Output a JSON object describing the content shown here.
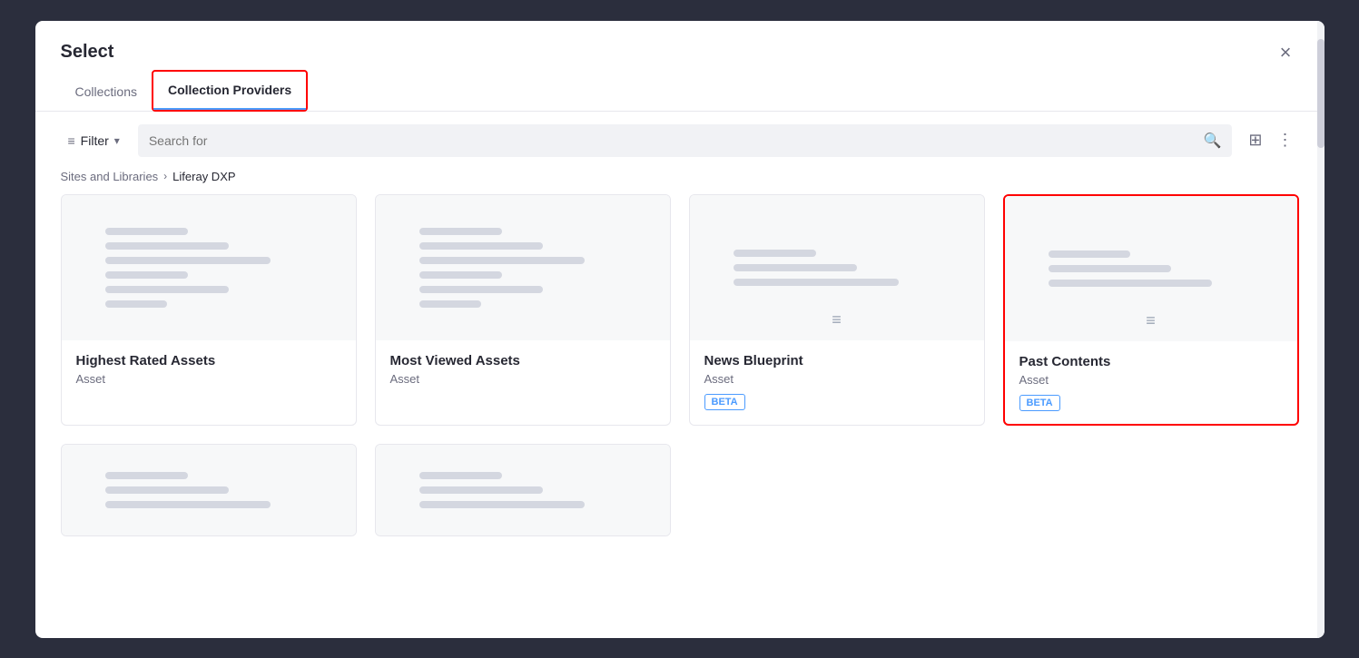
{
  "modal": {
    "title": "Select",
    "close_label": "×"
  },
  "tabs": [
    {
      "id": "collections",
      "label": "Collections",
      "active": false,
      "highlighted": false
    },
    {
      "id": "collection-providers",
      "label": "Collection Providers",
      "active": true,
      "highlighted": true
    }
  ],
  "toolbar": {
    "filter_label": "Filter",
    "filter_icon": "☰",
    "chevron_icon": "▾",
    "search_placeholder": "Search for",
    "search_icon": "🔍",
    "grid_icon": "⊞",
    "options_icon": "⋮"
  },
  "breadcrumb": {
    "root": "Sites and Libraries",
    "separator": "›",
    "current": "Liferay DXP"
  },
  "cards": [
    {
      "id": "highest-rated",
      "title": "Highest Rated Assets",
      "subtitle": "Asset",
      "badge": null,
      "selected": false,
      "has_filter_icon": false
    },
    {
      "id": "most-viewed",
      "title": "Most Viewed Assets",
      "subtitle": "Asset",
      "badge": null,
      "selected": false,
      "has_filter_icon": false
    },
    {
      "id": "news-blueprint",
      "title": "News Blueprint",
      "subtitle": "Asset",
      "badge": "BETA",
      "selected": false,
      "has_filter_icon": true
    },
    {
      "id": "past-contents",
      "title": "Past Contents",
      "subtitle": "Asset",
      "badge": "BETA",
      "selected": true,
      "has_filter_icon": true
    }
  ],
  "partial_cards": [
    {
      "id": "partial-1"
    },
    {
      "id": "partial-2"
    }
  ],
  "colors": {
    "accent_blue": "#4b9bff",
    "highlight_red": "#ff0000",
    "skeleton": "#d4d7e0"
  }
}
